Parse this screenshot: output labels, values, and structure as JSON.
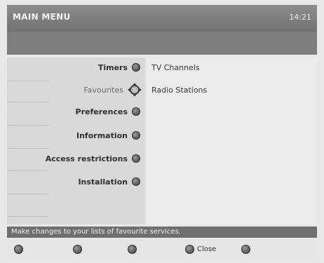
{
  "header": {
    "title": "MAIN MENU",
    "time": "14:21"
  },
  "menu": {
    "items": [
      {
        "label": "Timers"
      },
      {
        "label": "Favourites"
      },
      {
        "label": "Preferences"
      },
      {
        "label": "Information"
      },
      {
        "label": "Access restrictions"
      },
      {
        "label": "Installation"
      }
    ],
    "selected": "Favourites"
  },
  "submenu": {
    "items": [
      {
        "label": "TV Channels"
      },
      {
        "label": "Radio Stations"
      }
    ]
  },
  "status": {
    "text": "Make changes to your lists of favourite services."
  },
  "footer": {
    "buttons": [
      {
        "label": ""
      },
      {
        "label": ""
      },
      {
        "label": ""
      },
      {
        "label": "Close"
      },
      {
        "label": ""
      }
    ]
  },
  "icons": {
    "bullet": "remote-button-icon",
    "nav": "navigation-cursor-icon"
  },
  "colors": {
    "header_bg": "#7c7c7c",
    "panel_bg": "#dcdcdc",
    "status_bg": "#6f6f6f"
  }
}
